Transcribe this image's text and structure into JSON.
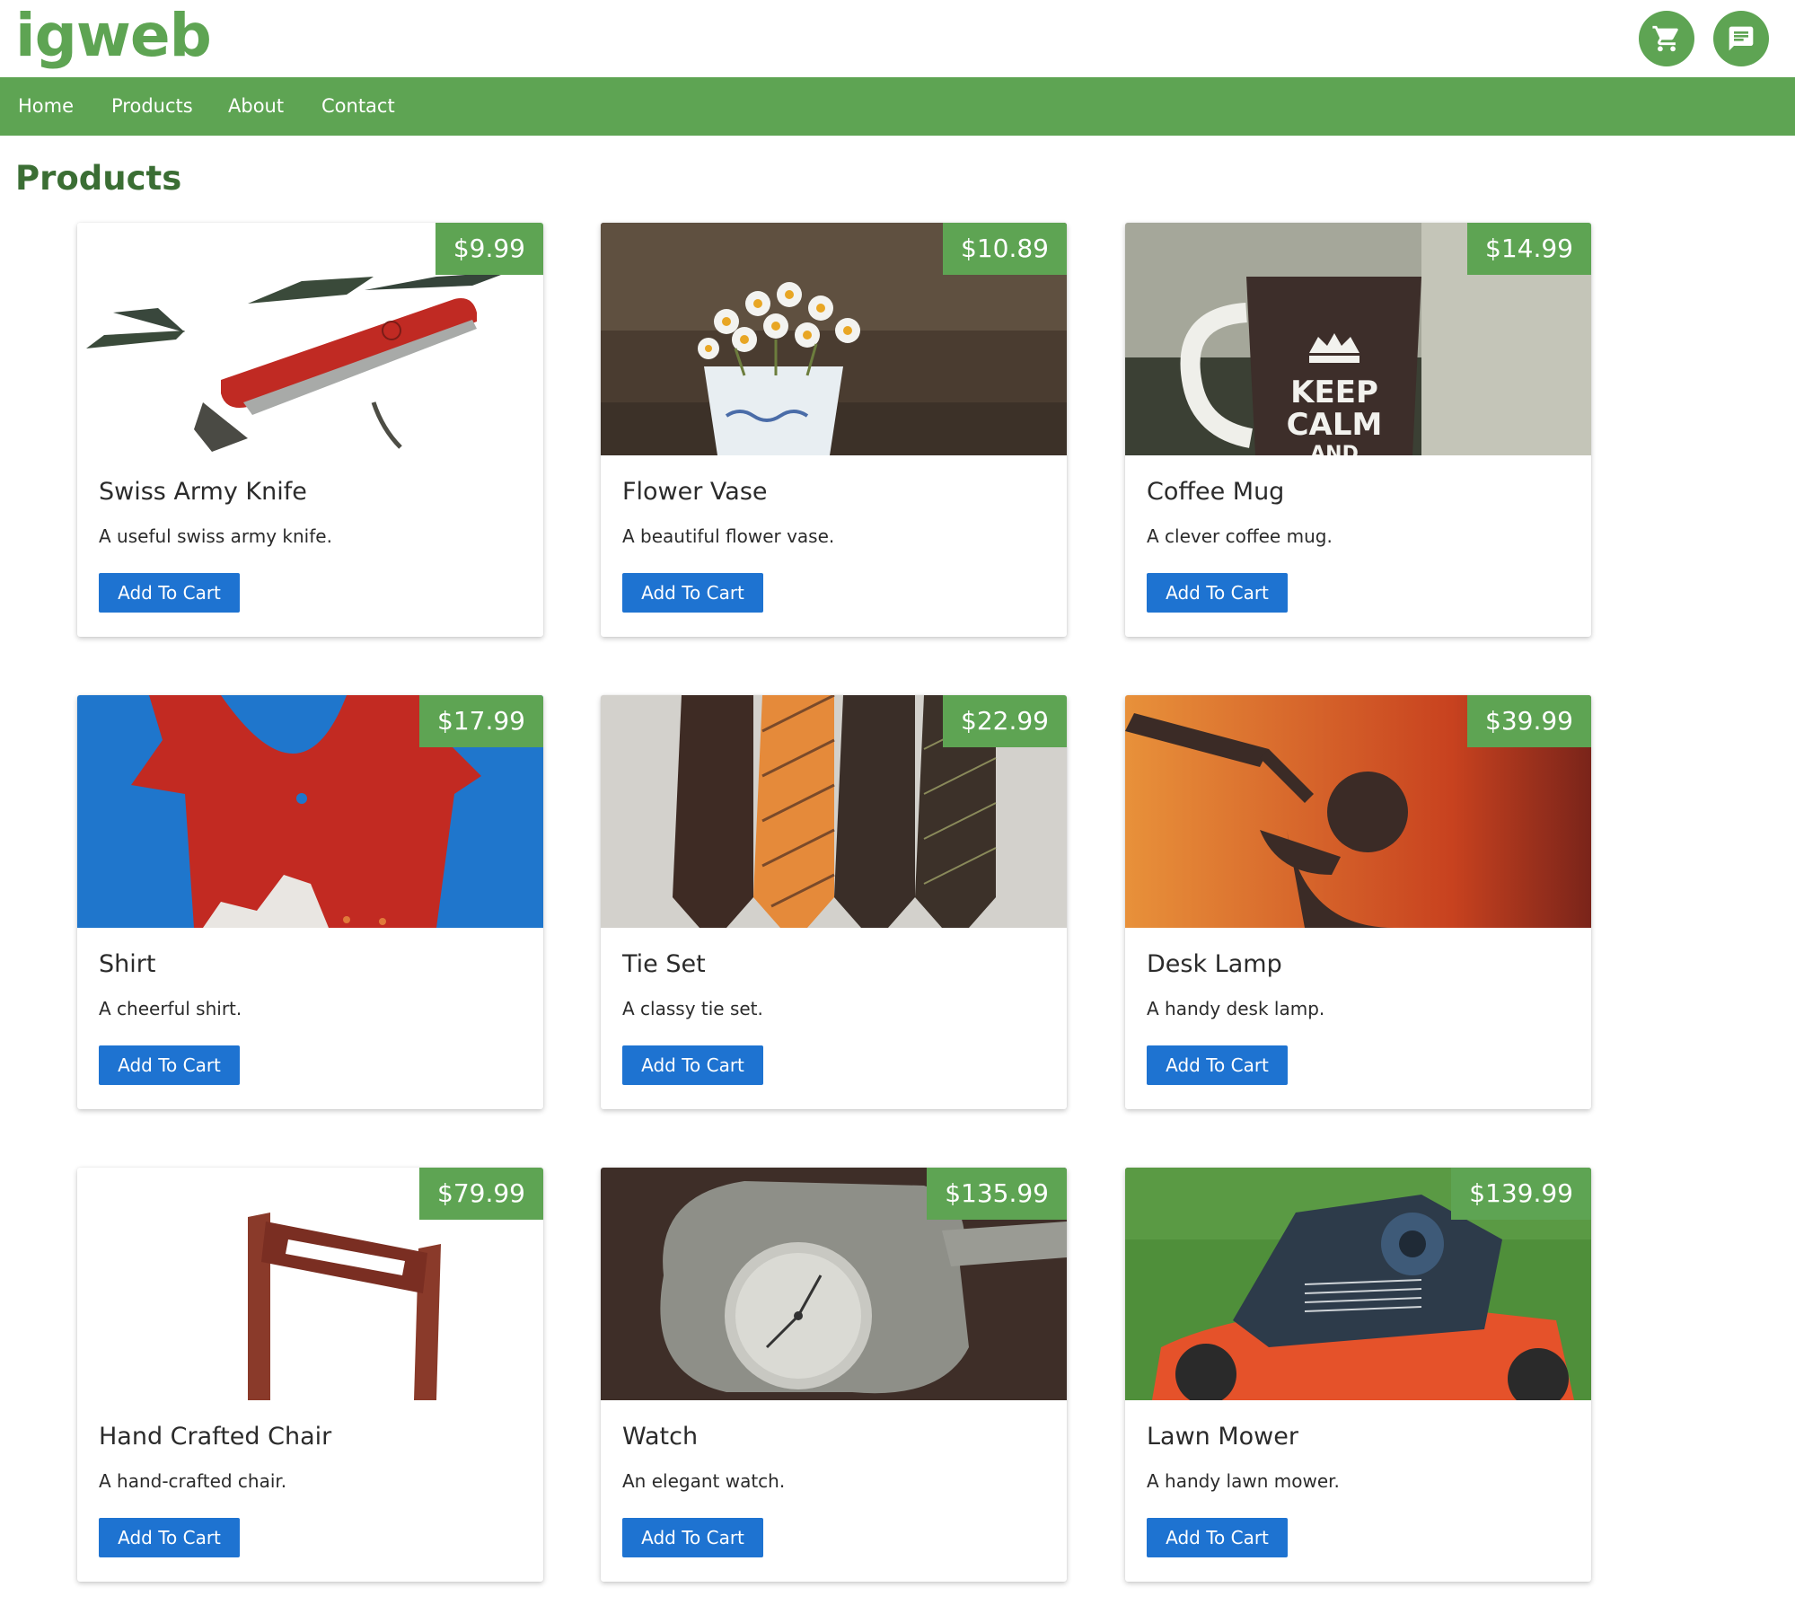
{
  "brand": {
    "logo": "igweb"
  },
  "header_icons": {
    "cart": "cart-icon",
    "chat": "chat-icon"
  },
  "nav": {
    "items": [
      {
        "label": "Home"
      },
      {
        "label": "Products"
      },
      {
        "label": "About"
      },
      {
        "label": "Contact"
      }
    ]
  },
  "page": {
    "title": "Products"
  },
  "colors": {
    "accent": "#5ea453",
    "button": "#1e73d1",
    "title": "#3b6e34"
  },
  "products": [
    {
      "name": "Swiss Army Knife",
      "description": "A useful swiss army knife.",
      "price": "$9.99",
      "button": "Add To Cart"
    },
    {
      "name": "Flower Vase",
      "description": "A beautiful flower vase.",
      "price": "$10.89",
      "button": "Add To Cart"
    },
    {
      "name": "Coffee Mug",
      "description": "A clever coffee mug.",
      "price": "$14.99",
      "button": "Add To Cart",
      "image_text": [
        "KEEP",
        "CALM",
        "AND"
      ]
    },
    {
      "name": "Shirt",
      "description": "A cheerful shirt.",
      "price": "$17.99",
      "button": "Add To Cart"
    },
    {
      "name": "Tie Set",
      "description": "A classy tie set.",
      "price": "$22.99",
      "button": "Add To Cart"
    },
    {
      "name": "Desk Lamp",
      "description": "A handy desk lamp.",
      "price": "$39.99",
      "button": "Add To Cart"
    },
    {
      "name": "Hand Crafted Chair",
      "description": "A hand-crafted chair.",
      "price": "$79.99",
      "button": "Add To Cart"
    },
    {
      "name": "Watch",
      "description": "An elegant watch.",
      "price": "$135.99",
      "button": "Add To Cart"
    },
    {
      "name": "Lawn Mower",
      "description": "A handy lawn mower.",
      "price": "$139.99",
      "button": "Add To Cart"
    }
  ]
}
